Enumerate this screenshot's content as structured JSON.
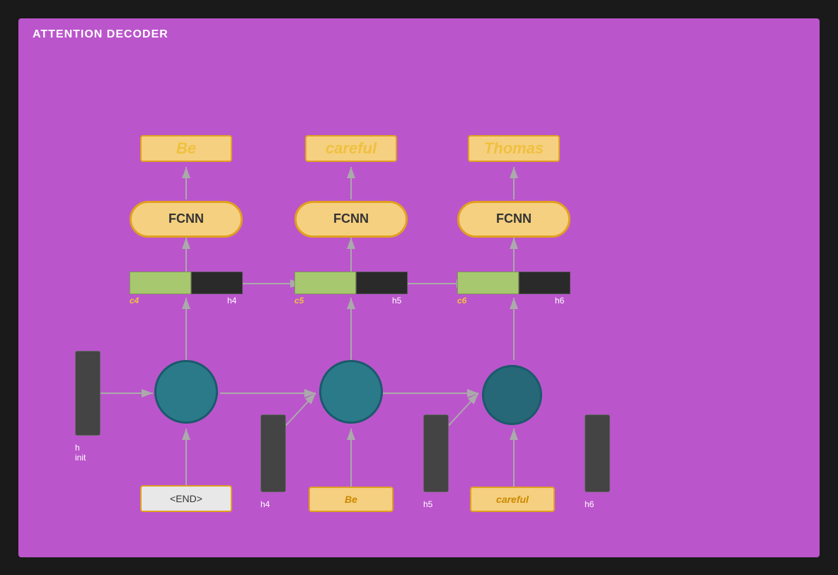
{
  "title": "ATTENTION DECODER",
  "columns": [
    {
      "id": "col1",
      "output_word": "Be",
      "fcnn_label": "FCNN",
      "state_c": "c4",
      "state_h": "h4",
      "circle_size": 90,
      "h_bar_label_bottom": "h4",
      "input_token": "<END>",
      "input_token_type": "end"
    },
    {
      "id": "col2",
      "output_word": "careful",
      "fcnn_label": "FCNN",
      "state_c": "c5",
      "state_h": "h5",
      "circle_size": 90,
      "h_bar_label_bottom": "h5",
      "input_token": "Be",
      "input_token_type": "word"
    },
    {
      "id": "col3",
      "output_word": "Thomas",
      "fcnn_label": "FCNN",
      "state_c": "c6",
      "state_h": "h6",
      "circle_size": 85,
      "h_bar_label_bottom": "h6",
      "input_token": "careful",
      "input_token_type": "word"
    }
  ],
  "init_label": "h\ninit",
  "extra_h_bars": [
    "h4",
    "h5",
    "h6"
  ]
}
